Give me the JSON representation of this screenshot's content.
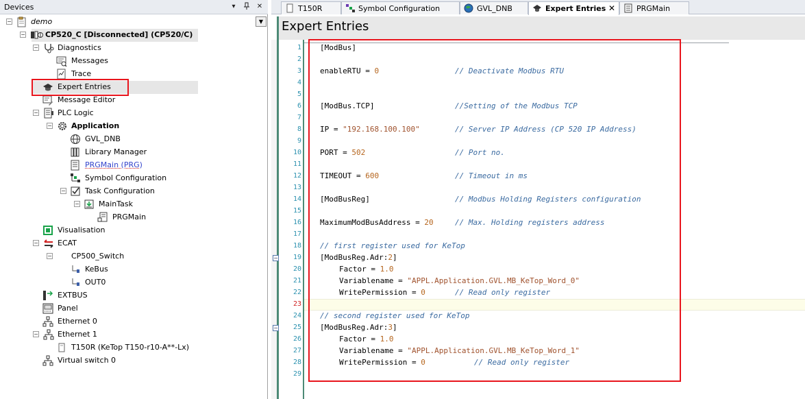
{
  "devices_pane": {
    "title": "Devices",
    "pin_icon": "pin-icon",
    "menu_icon": "menu-arrow-icon",
    "close_icon": "close-icon",
    "dropdown_icon": "dropdown-arrow-icon"
  },
  "tree": {
    "demo": "demo",
    "controller": "CP520_C [Disconnected] (CP520/C)",
    "diagnostics": "Diagnostics",
    "messages": "Messages",
    "trace": "Trace",
    "expert_entries": "Expert Entries",
    "message_editor": "Message Editor",
    "plc_logic": "PLC Logic",
    "application": "Application",
    "gvl_dnb": "GVL_DNB",
    "library_manager": "Library Manager",
    "prgmain_prg": "PRGMain (PRG)",
    "symbol_configuration": "Symbol Configuration",
    "task_configuration": "Task Configuration",
    "maintask": "MainTask",
    "prgmain": "PRGMain",
    "visualisation": "Visualisation",
    "ecat": "ECAT",
    "cp500_switch": "CP500_Switch",
    "kebus": "KeBus",
    "out0": "OUT0",
    "extbus": "EXTBUS",
    "panel": "Panel",
    "ethernet0": "Ethernet 0",
    "ethernet1": "Ethernet 1",
    "t150r": "T150R (KeTop T150-r10-A**-Lx)",
    "virtual_switch": "Virtual switch 0"
  },
  "tabs": [
    {
      "label": "T150R",
      "icon": "document-icon"
    },
    {
      "label": "Symbol Configuration",
      "icon": "symbol-config-icon"
    },
    {
      "label": "GVL_DNB",
      "icon": "globe-icon"
    },
    {
      "label": "Expert Entries",
      "icon": "graduation-cap-icon",
      "active": true
    },
    {
      "label": "PRGMain",
      "icon": "program-icon"
    }
  ],
  "editor": {
    "title": "Expert Entries",
    "current_line": 23,
    "lines": [
      "1",
      "2",
      "3",
      "4",
      "5",
      "6",
      "7",
      "8",
      "9",
      "10",
      "11",
      "12",
      "13",
      "14",
      "15",
      "16",
      "17",
      "18",
      "19",
      "20",
      "21",
      "22",
      "23",
      "24",
      "25",
      "26",
      "27",
      "28",
      "29"
    ],
    "code": {
      "l1": "[ModBus]",
      "l3_a": "enableRTU = ",
      "l3_num": "0",
      "l3_cmt": "// Deactivate Modbus RTU",
      "l6_a": "[ModBus.TCP]",
      "l6_cmt": "//Setting of the Modbus TCP",
      "l8_a": "IP = ",
      "l8_str": "\"192.168.100.100\"",
      "l8_cmt": "// Server IP Address (CP 520 IP Address)",
      "l10_a": "PORT = ",
      "l10_num": "502",
      "l10_cmt": "// Port no.",
      "l12_a": "TIMEOUT = ",
      "l12_num": "600",
      "l12_cmt": "// Timeout in ms",
      "l14_a": "[ModBusReg]",
      "l14_cmt": "// Modbus Holding Registers configuration",
      "l16_a": "MaximumModBusAddress = ",
      "l16_num": "20",
      "l16_cmt": "// Max. Holding registers address",
      "l18_cmt": "// first register used for KeTop",
      "l19_a": "[ModBusReg.Adr:",
      "l19_num": "2",
      "l19_b": "]",
      "l20_a": "Factor = ",
      "l20_num": "1.0",
      "l21_a": "Variablename = ",
      "l21_str": "\"APPL.Application.GVL.MB_KeTop_Word_0\"",
      "l22_a": "WritePermission = ",
      "l22_num": "0",
      "l22_cmt": "// Read only register",
      "l24_cmt": "// second register used for KeTop",
      "l25_a": "[ModBusReg.Adr:",
      "l25_num": "3",
      "l25_b": "]",
      "l26_a": "Factor = ",
      "l26_num": "1.0",
      "l27_a": "Variablename = ",
      "l27_str": "\"APPL.Application.GVL.MB_KeTop_Word_1\"",
      "l28_a": "WritePermission = ",
      "l28_num": "0",
      "l28_cmt": "// Read only register"
    }
  },
  "colors": {
    "highlight_box": "#e8141c",
    "editor_accent": "#4c8a76",
    "comment": "#3a6aa0",
    "number": "#b5651d",
    "line_number": "#2b91af"
  }
}
